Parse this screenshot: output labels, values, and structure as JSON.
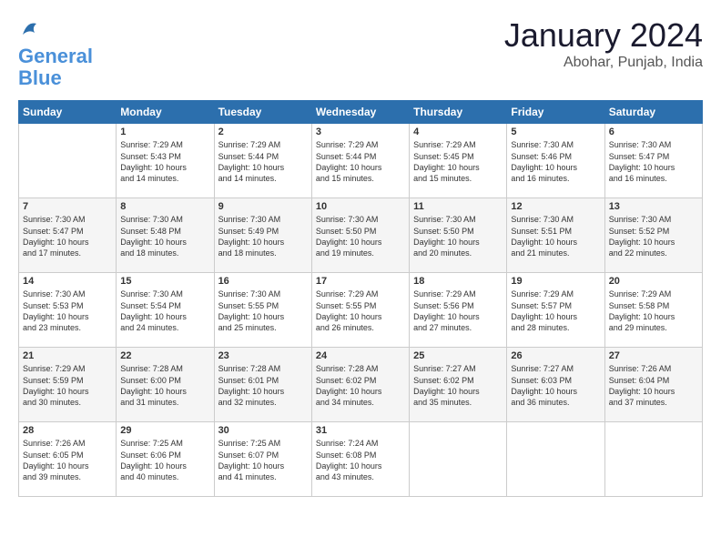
{
  "header": {
    "logo_general": "General",
    "logo_blue": "Blue",
    "month": "January 2024",
    "location": "Abohar, Punjab, India"
  },
  "weekdays": [
    "Sunday",
    "Monday",
    "Tuesday",
    "Wednesday",
    "Thursday",
    "Friday",
    "Saturday"
  ],
  "weeks": [
    [
      {
        "day": "",
        "info": ""
      },
      {
        "day": "1",
        "info": "Sunrise: 7:29 AM\nSunset: 5:43 PM\nDaylight: 10 hours\nand 14 minutes."
      },
      {
        "day": "2",
        "info": "Sunrise: 7:29 AM\nSunset: 5:44 PM\nDaylight: 10 hours\nand 14 minutes."
      },
      {
        "day": "3",
        "info": "Sunrise: 7:29 AM\nSunset: 5:44 PM\nDaylight: 10 hours\nand 15 minutes."
      },
      {
        "day": "4",
        "info": "Sunrise: 7:29 AM\nSunset: 5:45 PM\nDaylight: 10 hours\nand 15 minutes."
      },
      {
        "day": "5",
        "info": "Sunrise: 7:30 AM\nSunset: 5:46 PM\nDaylight: 10 hours\nand 16 minutes."
      },
      {
        "day": "6",
        "info": "Sunrise: 7:30 AM\nSunset: 5:47 PM\nDaylight: 10 hours\nand 16 minutes."
      }
    ],
    [
      {
        "day": "7",
        "info": "Sunrise: 7:30 AM\nSunset: 5:47 PM\nDaylight: 10 hours\nand 17 minutes."
      },
      {
        "day": "8",
        "info": "Sunrise: 7:30 AM\nSunset: 5:48 PM\nDaylight: 10 hours\nand 18 minutes."
      },
      {
        "day": "9",
        "info": "Sunrise: 7:30 AM\nSunset: 5:49 PM\nDaylight: 10 hours\nand 18 minutes."
      },
      {
        "day": "10",
        "info": "Sunrise: 7:30 AM\nSunset: 5:50 PM\nDaylight: 10 hours\nand 19 minutes."
      },
      {
        "day": "11",
        "info": "Sunrise: 7:30 AM\nSunset: 5:50 PM\nDaylight: 10 hours\nand 20 minutes."
      },
      {
        "day": "12",
        "info": "Sunrise: 7:30 AM\nSunset: 5:51 PM\nDaylight: 10 hours\nand 21 minutes."
      },
      {
        "day": "13",
        "info": "Sunrise: 7:30 AM\nSunset: 5:52 PM\nDaylight: 10 hours\nand 22 minutes."
      }
    ],
    [
      {
        "day": "14",
        "info": "Sunrise: 7:30 AM\nSunset: 5:53 PM\nDaylight: 10 hours\nand 23 minutes."
      },
      {
        "day": "15",
        "info": "Sunrise: 7:30 AM\nSunset: 5:54 PM\nDaylight: 10 hours\nand 24 minutes."
      },
      {
        "day": "16",
        "info": "Sunrise: 7:30 AM\nSunset: 5:55 PM\nDaylight: 10 hours\nand 25 minutes."
      },
      {
        "day": "17",
        "info": "Sunrise: 7:29 AM\nSunset: 5:55 PM\nDaylight: 10 hours\nand 26 minutes."
      },
      {
        "day": "18",
        "info": "Sunrise: 7:29 AM\nSunset: 5:56 PM\nDaylight: 10 hours\nand 27 minutes."
      },
      {
        "day": "19",
        "info": "Sunrise: 7:29 AM\nSunset: 5:57 PM\nDaylight: 10 hours\nand 28 minutes."
      },
      {
        "day": "20",
        "info": "Sunrise: 7:29 AM\nSunset: 5:58 PM\nDaylight: 10 hours\nand 29 minutes."
      }
    ],
    [
      {
        "day": "21",
        "info": "Sunrise: 7:29 AM\nSunset: 5:59 PM\nDaylight: 10 hours\nand 30 minutes."
      },
      {
        "day": "22",
        "info": "Sunrise: 7:28 AM\nSunset: 6:00 PM\nDaylight: 10 hours\nand 31 minutes."
      },
      {
        "day": "23",
        "info": "Sunrise: 7:28 AM\nSunset: 6:01 PM\nDaylight: 10 hours\nand 32 minutes."
      },
      {
        "day": "24",
        "info": "Sunrise: 7:28 AM\nSunset: 6:02 PM\nDaylight: 10 hours\nand 34 minutes."
      },
      {
        "day": "25",
        "info": "Sunrise: 7:27 AM\nSunset: 6:02 PM\nDaylight: 10 hours\nand 35 minutes."
      },
      {
        "day": "26",
        "info": "Sunrise: 7:27 AM\nSunset: 6:03 PM\nDaylight: 10 hours\nand 36 minutes."
      },
      {
        "day": "27",
        "info": "Sunrise: 7:26 AM\nSunset: 6:04 PM\nDaylight: 10 hours\nand 37 minutes."
      }
    ],
    [
      {
        "day": "28",
        "info": "Sunrise: 7:26 AM\nSunset: 6:05 PM\nDaylight: 10 hours\nand 39 minutes."
      },
      {
        "day": "29",
        "info": "Sunrise: 7:25 AM\nSunset: 6:06 PM\nDaylight: 10 hours\nand 40 minutes."
      },
      {
        "day": "30",
        "info": "Sunrise: 7:25 AM\nSunset: 6:07 PM\nDaylight: 10 hours\nand 41 minutes."
      },
      {
        "day": "31",
        "info": "Sunrise: 7:24 AM\nSunset: 6:08 PM\nDaylight: 10 hours\nand 43 minutes."
      },
      {
        "day": "",
        "info": ""
      },
      {
        "day": "",
        "info": ""
      },
      {
        "day": "",
        "info": ""
      }
    ]
  ]
}
